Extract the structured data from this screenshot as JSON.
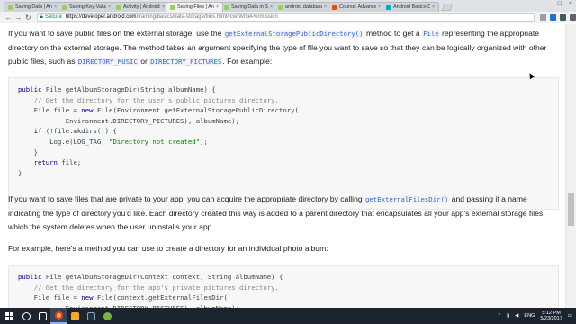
{
  "browser": {
    "tabs": [
      {
        "title": "Saving Data | Andro",
        "fav": "#9ccc65",
        "active": false
      },
      {
        "title": "Saving Key-Value S",
        "fav": "#9ccc65",
        "active": false
      },
      {
        "title": "Activity | Android D",
        "fav": "#9ccc65",
        "active": false
      },
      {
        "title": "Saving Files | Andr",
        "fav": "#9ccc65",
        "active": true
      },
      {
        "title": "Saving Data in SQL",
        "fav": "#9ccc65",
        "active": false
      },
      {
        "title": "android.database.",
        "fav": "#9ccc65",
        "active": false
      },
      {
        "title": "Course: Advanced",
        "fav": "#e65100",
        "active": false
      },
      {
        "title": "Android Basics D",
        "fav": "#00acc1",
        "active": false
      }
    ],
    "secure_label": "Secure",
    "url_host": "https://developer.android.com",
    "url_path": "/training/basics/data-storage/files.html#GetWritePermission",
    "icons": [
      "star-icon",
      "extension-icon",
      "profile-icon",
      "menu-icon"
    ]
  },
  "content": {
    "para1": {
      "t1": "If you want to save public files on the external storage, use the ",
      "c1": "getExternalStoragePublicDirectory()",
      "t2": " method to get a ",
      "c2": "File",
      "t3": " representing the appropriate directory on the external storage. The method takes an argument specifying the type of file you want to save so that they can be logically organized with other public files, such as ",
      "c3": "DIRECTORY_MUSIC",
      "t4": " or ",
      "c4": "DIRECTORY_PICTURES",
      "t5": ". For example:"
    },
    "code1": [
      "public File getAlbumStorageDir(String albumName) {",
      "    // Get the directory for the user's public pictures directory.",
      "    File file = new File(Environment.getExternalStoragePublicDirectory(",
      "            Environment.DIRECTORY_PICTURES), albumName);",
      "    if (!file.mkdirs()) {",
      "        Log.e(LOG_TAG, \"Directory not created\");",
      "    }",
      "    return file;",
      "}"
    ],
    "para2": {
      "t1": "If you want to save files that are private to your app, you can acquire the appropriate directory by calling ",
      "c1": "getExternalFilesDir()",
      "t2": " and passing it a name indicating the type of directory you'd like. Each directory created this way is added to a parent directory that encapsulates all your app's external storage files, which the system deletes when the user uninstalls your app."
    },
    "para3": "For example, here's a method you can use to create a directory for an individual photo album:",
    "code2": [
      "public File getAlbumStorageDir(Context context, String albumName) {",
      "    // Get the directory for the app's private pictures directory.",
      "    File file = new File(context.getExternalFilesDir(",
      "            Environment.DIRECTORY_PICTURES), albumName);"
    ]
  },
  "taskbar": {
    "lang": "ENG",
    "time": "5:12 PM",
    "date": "5/23/2017",
    "apps": [
      "cortana-icon",
      "task-view-icon",
      "chrome-icon",
      "file-explorer-icon",
      "terminal-icon",
      "android-studio-icon"
    ]
  }
}
